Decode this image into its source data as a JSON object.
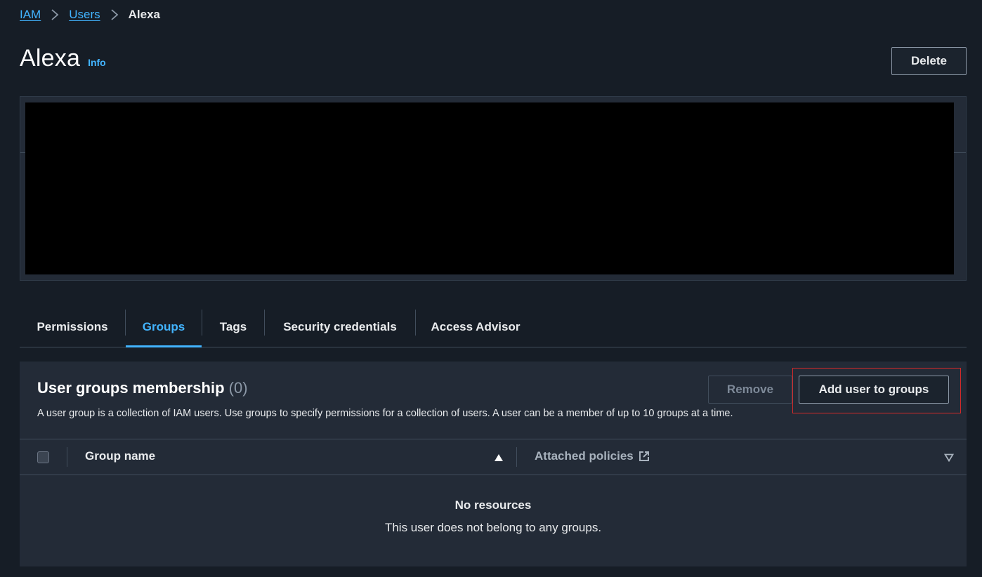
{
  "breadcrumb": {
    "items": [
      "IAM",
      "Users"
    ],
    "current": "Alexa"
  },
  "page": {
    "title": "Alexa",
    "info_label": "Info",
    "delete_label": "Delete"
  },
  "tabs": [
    {
      "label": "Permissions",
      "active": false
    },
    {
      "label": "Groups",
      "active": true
    },
    {
      "label": "Tags",
      "active": false
    },
    {
      "label": "Security credentials",
      "active": false
    },
    {
      "label": "Access Advisor",
      "active": false
    }
  ],
  "groups": {
    "title": "User groups membership",
    "count": "(0)",
    "description": "A user group is a collection of IAM users. Use groups to specify permissions for a collection of users. A user can be a member of up to 10 groups at a time.",
    "remove_label": "Remove",
    "add_label": "Add user to groups",
    "columns": {
      "group_name": "Group name",
      "attached_policies": "Attached policies"
    },
    "empty_title": "No resources",
    "empty_text": "This user does not belong to any groups."
  },
  "colors": {
    "link": "#42b4ff",
    "background": "#161d26",
    "panel": "#232b37",
    "highlight": "#d42a2a"
  },
  "icons": [
    "chevron-right-icon",
    "sort-ascending-icon",
    "sort-descending-icon",
    "external-link-icon"
  ]
}
